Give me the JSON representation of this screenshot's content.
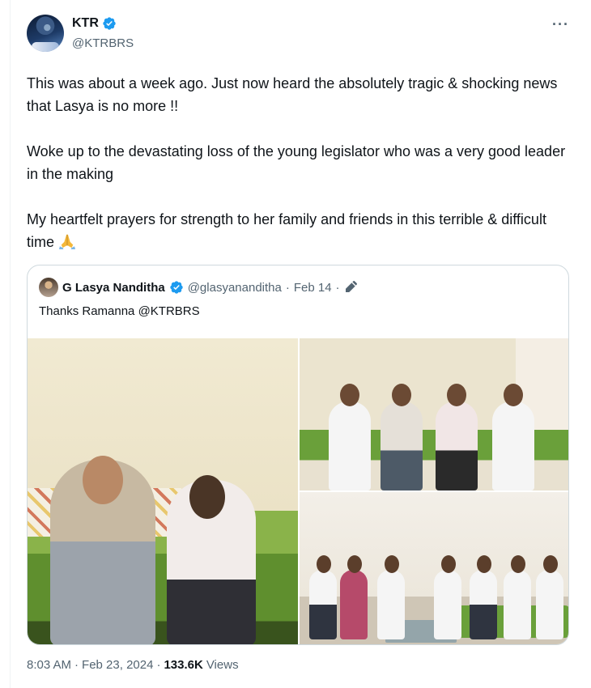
{
  "author": {
    "display_name": "KTR",
    "handle": "@KTRBRS",
    "verified": true,
    "avatar_icon": "profile-photo"
  },
  "more_icon": "more-horizontal-icon",
  "tweet": {
    "paragraphs": [
      "This was about a week ago. Just now heard the absolutely tragic & shocking news that Lasya is no more !!",
      "Woke up to the devastating loss of the young legislator who was a very good leader in the making",
      "My heartfelt prayers for strength to her family and friends in this terrible & difficult time"
    ],
    "trailing_emoji": "folded-hands-emoji"
  },
  "quote": {
    "display_name": "G Lasya Nanditha",
    "handle": "@glasyananditha",
    "separator": "·",
    "date": "Feb 14",
    "separator_2": "·",
    "edited_icon": "pencil-icon",
    "text": "Thanks Ramanna @KTRBRS",
    "media_count": 3
  },
  "meta": {
    "time": "8:03 AM",
    "separator": "·",
    "date": "Feb 23, 2024",
    "separator_2": "·",
    "views_count": "133.6K",
    "views_label": "Views"
  },
  "colors": {
    "accent_verified": "#1d9bf0",
    "text_primary": "#0f1419",
    "text_secondary": "#536471",
    "border": "#cfd9de"
  }
}
